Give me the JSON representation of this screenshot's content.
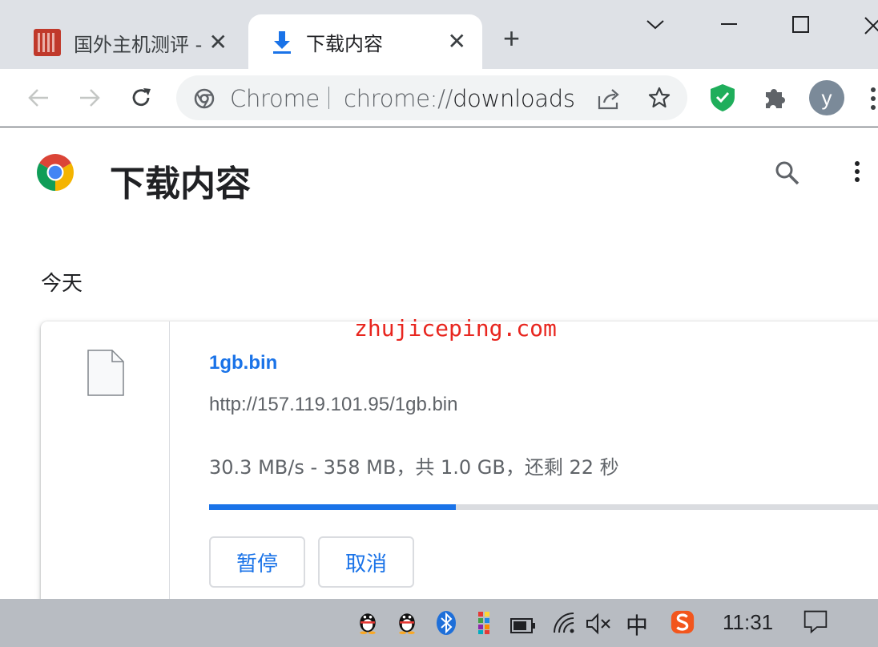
{
  "tabs": [
    {
      "title": "国外主机测评 - ",
      "close": "✕",
      "active": false
    },
    {
      "title": "下载内容",
      "close": "✕",
      "active": true
    }
  ],
  "new_tab": "+",
  "toolbar": {
    "omnibox_label": "Chrome",
    "url_scheme": "chrome://",
    "url_path": "downloads",
    "avatar_letter": "y"
  },
  "page": {
    "title": "下载内容",
    "date_heading": "今天"
  },
  "download": {
    "file_name": "1gb.bin",
    "url": "http://157.119.101.95/1gb.bin",
    "status": "30.3 MB/s - 358 MB，共 1.0 GB，还剩 22 秒",
    "progress": 0.358,
    "pause_label": "暂停",
    "cancel_label": "取消"
  },
  "watermark": "zhujiceping.com",
  "taskbar": {
    "ime": "中",
    "clock": "11:31"
  },
  "colors": {
    "accent": "#1a73e8",
    "watermark": "#e8261f",
    "shield": "#1fae5b",
    "sogou": "#f2561d"
  }
}
